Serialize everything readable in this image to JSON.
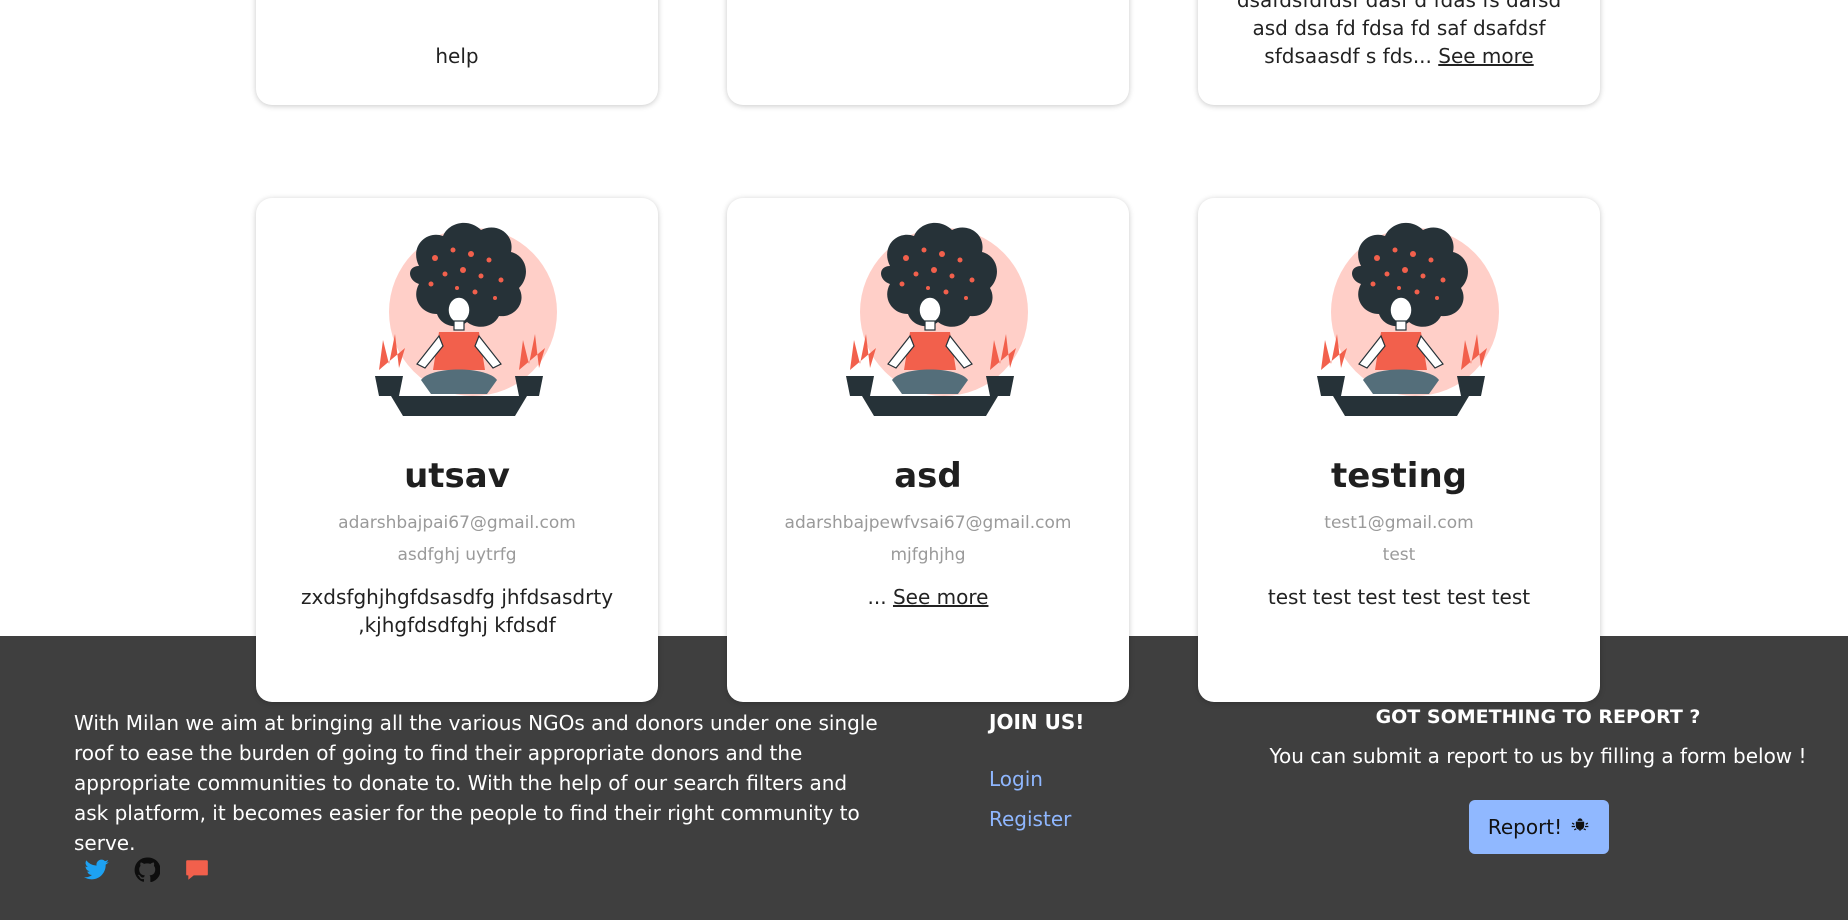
{
  "top_cards": [
    {
      "text": "help",
      "see_more": ""
    },
    {
      "text": "",
      "see_more": ""
    },
    {
      "text": "dsafdsfdfdsf dasf d fdas fs dafsd asd dsa fd fdsa fd saf dsafdsf sfdsaasdf s fds...",
      "see_more": "See more"
    }
  ],
  "cards": [
    {
      "name": "utsav",
      "email": "adarshbajpai67@gmail.com",
      "subtitle": "asdfghj uytrfg",
      "description": "zxdsfghjhgfdsasdfg jhfdsasdrty ,kjhgfdsdfghj kfdsdf",
      "see_more": ""
    },
    {
      "name": "asd",
      "email": "adarshbajpewfvsai67@gmail.com",
      "subtitle": "mjfghjhg",
      "description": "...",
      "see_more": "See more"
    },
    {
      "name": "testing",
      "email": "test1@gmail.com",
      "subtitle": "test",
      "description": "test test test test test test",
      "see_more": ""
    }
  ],
  "footer": {
    "about": "With Milan we aim at bringing all the various NGOs and donors under one single roof to ease the burden of going to find their appropriate donors and the appropriate communities to donate to. With the help of our search filters and ask platform, it becomes easier for the people to find their right community to serve.",
    "socials": [
      "twitter-icon",
      "github-icon",
      "chat-icon"
    ],
    "join_title": "JOIN US!",
    "login": "Login",
    "register": "Register",
    "report_title": "GOT SOMETHING TO REPORT ?",
    "report_text": "You can submit a report to us by filling a form below !",
    "report_button": "Report!"
  },
  "colors": {
    "footer_bg": "#3f3f3f",
    "link": "#8fb7ff",
    "button": "#90b8ff",
    "accent": "#f2604c",
    "twitter": "#1da1f2"
  }
}
